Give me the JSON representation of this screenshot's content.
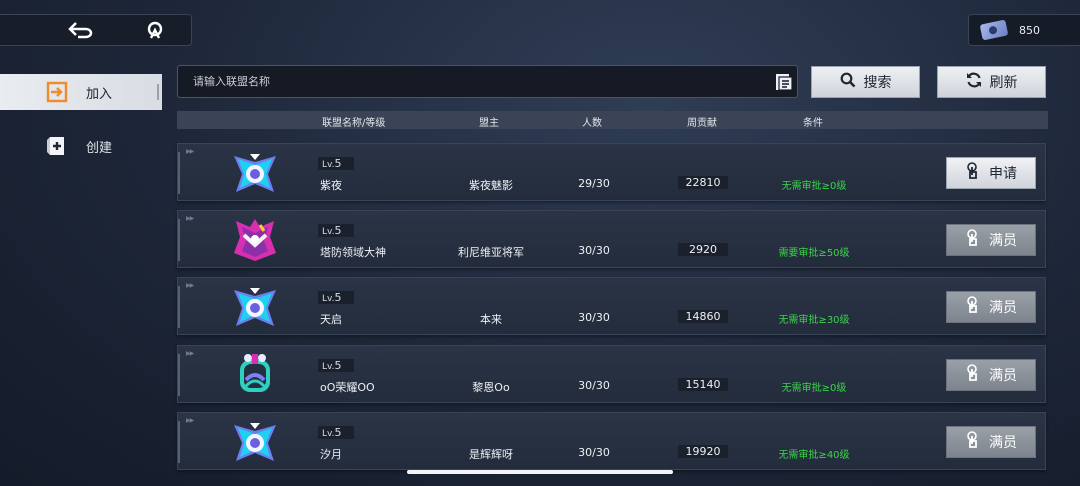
{
  "topbar": {
    "back_icon": "back-arrow-icon",
    "home_icon": "home-icon",
    "currency_icon": "ticket-icon",
    "currency_value": "850"
  },
  "sidebar": {
    "items": [
      {
        "label": "加入",
        "icon": "join-icon",
        "active": true
      },
      {
        "label": "创建",
        "icon": "create-icon",
        "active": false
      }
    ]
  },
  "search": {
    "placeholder": "请输入联盟名称",
    "value": ""
  },
  "buttons": {
    "search_label": "搜索",
    "refresh_label": "刷新"
  },
  "columns": {
    "name_level": "联盟名称/等级",
    "leader": "盟主",
    "members": "人数",
    "weekly_contribution": "周贡献",
    "condition": "条件"
  },
  "rows": [
    {
      "level_prefix": "Lv.",
      "level": "5",
      "name": "紫夜",
      "leader": "紫夜魅影",
      "members": "29/30",
      "contribution": "22810",
      "condition": "无需审批≥0级",
      "action": "申请",
      "action_state": "apply",
      "emblem": "purple-star"
    },
    {
      "level_prefix": "Lv.",
      "level": "5",
      "name": "塔防领域大神",
      "leader": "利尼维亚将军",
      "members": "30/30",
      "contribution": "2920",
      "condition": "需要审批≥50级",
      "action": "满员",
      "action_state": "full",
      "emblem": "magenta-jester"
    },
    {
      "level_prefix": "Lv.",
      "level": "5",
      "name": "天启",
      "leader": "本来",
      "members": "30/30",
      "contribution": "14860",
      "condition": "无需审批≥30级",
      "action": "满员",
      "action_state": "full",
      "emblem": "purple-star"
    },
    {
      "level_prefix": "Lv.",
      "level": "5",
      "name": "oO荣耀OO",
      "leader": "黎恩Oo",
      "members": "30/30",
      "contribution": "15140",
      "condition": "无需审批≥0级",
      "action": "满员",
      "action_state": "full",
      "emblem": "teal-dragon"
    },
    {
      "level_prefix": "Lv.",
      "level": "5",
      "name": "汐月",
      "leader": "是辉辉呀",
      "members": "30/30",
      "contribution": "19920",
      "condition": "无需审批≥40级",
      "action": "满员",
      "action_state": "full",
      "emblem": "purple-star"
    }
  ],
  "colors": {
    "condition_green": "#3cd24a",
    "active_tab_icon": "#f08a2b"
  }
}
